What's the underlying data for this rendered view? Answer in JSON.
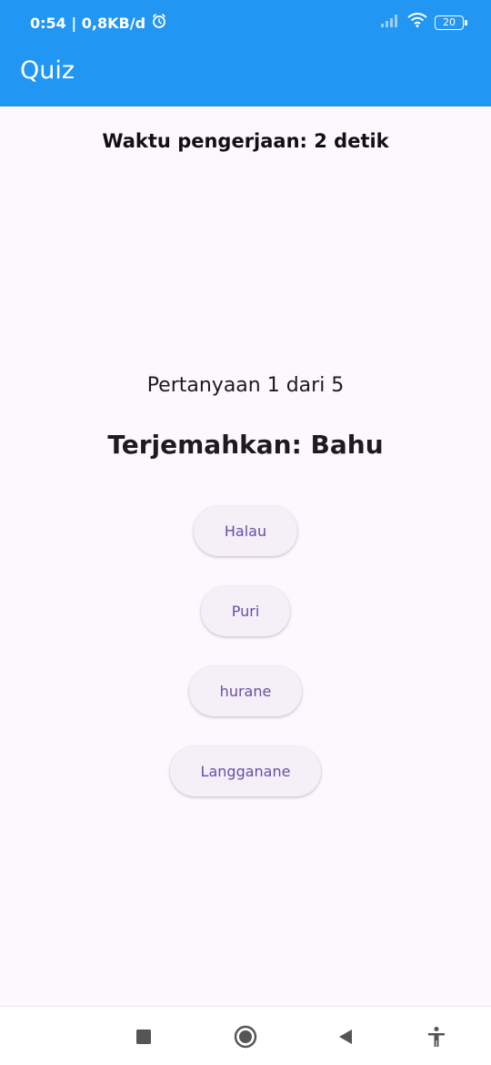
{
  "status_bar": {
    "time_network": "0:54 | 0,8KB/d",
    "battery": "20"
  },
  "app_bar": {
    "title": "Quiz",
    "color": "#2196f3"
  },
  "quiz": {
    "timer_text": "Waktu pengerjaan: 2 detik",
    "progress_text": "Pertanyaan 1 dari 5",
    "question_text": "Terjemahkan: Bahu",
    "answers": [
      {
        "label": "Halau"
      },
      {
        "label": "Puri"
      },
      {
        "label": "hurane"
      },
      {
        "label": "Langganane"
      }
    ]
  },
  "nav_bar": {
    "icons": [
      "recents-icon",
      "home-icon",
      "back-icon",
      "accessibility-icon"
    ]
  }
}
